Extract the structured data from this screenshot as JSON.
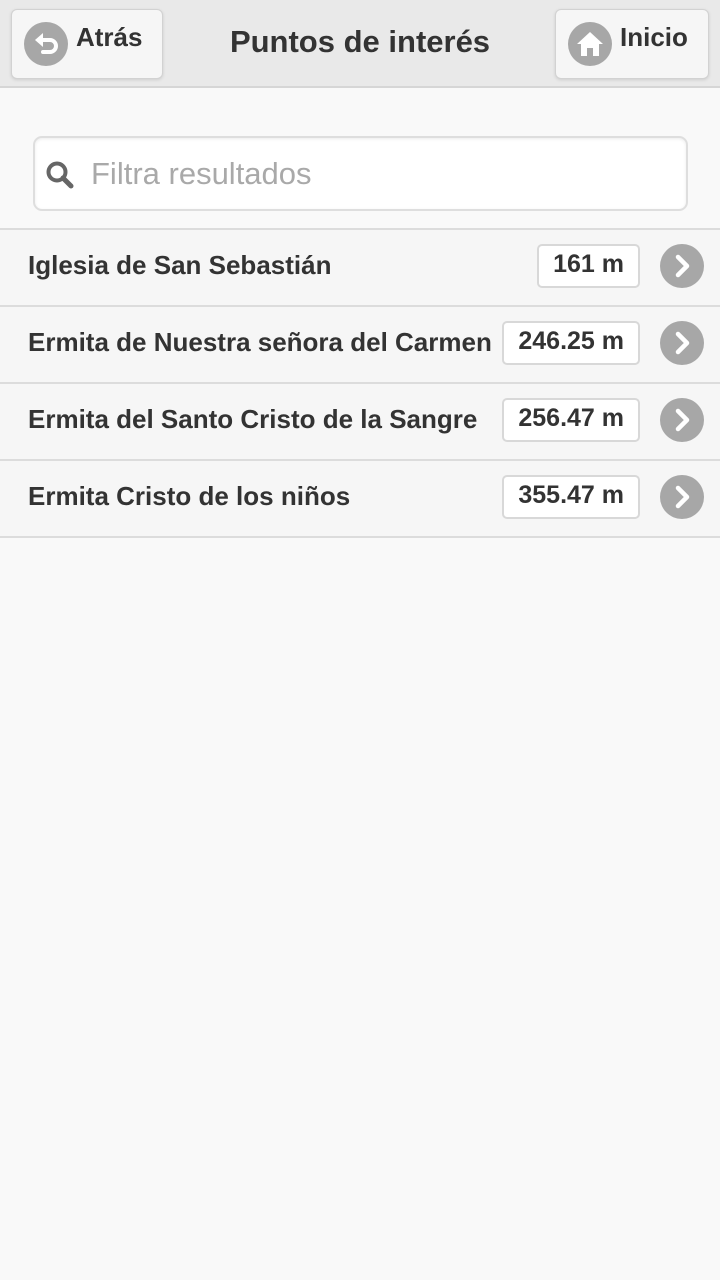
{
  "header": {
    "title": "Puntos de interés",
    "back_label": "Atrás",
    "home_label": "Inicio"
  },
  "search": {
    "placeholder": "Filtra resultados",
    "value": ""
  },
  "places": [
    {
      "name": "Iglesia de San Sebastián",
      "distance": "161 m"
    },
    {
      "name": "Ermita de Nuestra señora del Carmen",
      "distance": "246.25 m"
    },
    {
      "name": "Ermita del Santo Cristo de la Sangre",
      "distance": "256.47 m"
    },
    {
      "name": "Ermita Cristo de los niños",
      "distance": "355.47 m"
    }
  ],
  "icons": {
    "back": "undo-arrow-icon",
    "home": "home-icon",
    "search": "search-icon",
    "row_action": "chevron-right-icon"
  },
  "colors": {
    "header_bg": "#e9e9e9",
    "page_bg": "#f9f9f9",
    "icon_circle": "#a7a7a7",
    "text": "#333333"
  }
}
